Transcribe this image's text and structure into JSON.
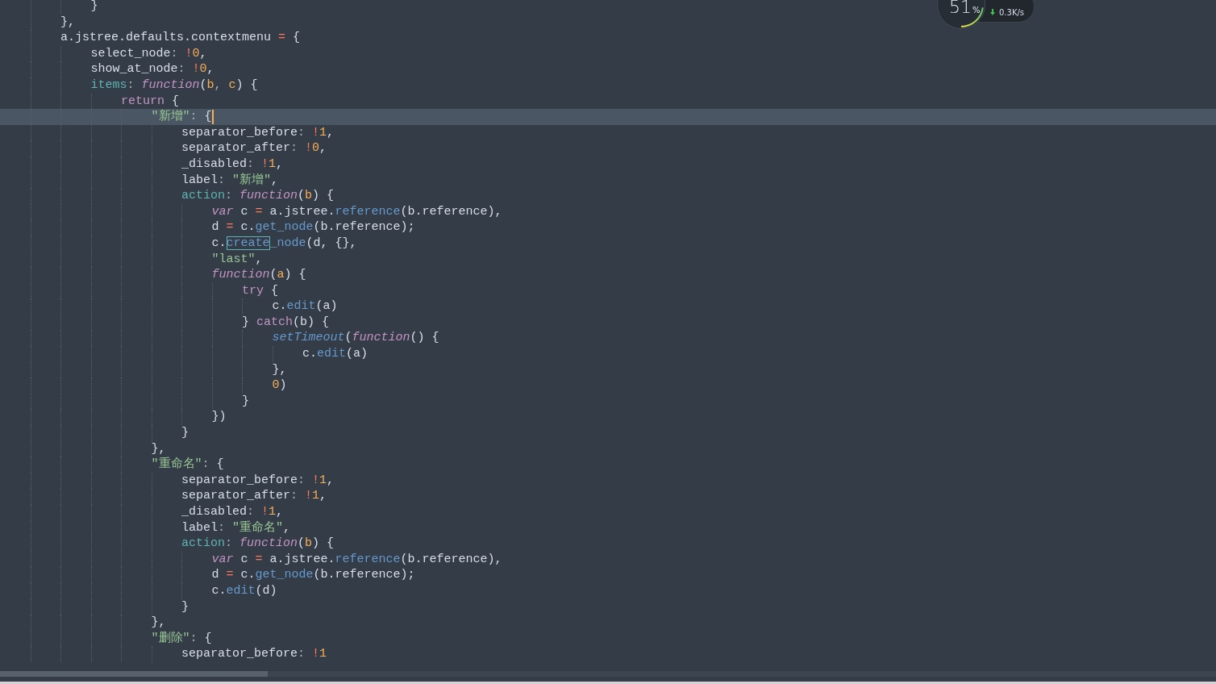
{
  "editor": {
    "lines": [
      {
        "children": [
          {
            "current": false,
            "tokens": [
              {
                "kind": "plain",
                "text": "}"
              }
            ]
          }
        ]
      },
      {
        "current": false,
        "tokens": [
          {
            "kind": "plain",
            "text": "},"
          }
        ]
      },
      {
        "current": false,
        "tokens": [
          {
            "kind": "plain",
            "text": "a.jstree.defaults.contextmenu "
          },
          {
            "kind": "op",
            "text": "="
          },
          {
            "kind": "plain",
            "text": " {"
          }
        ],
        "children": [
          {
            "current": false,
            "tokens": [
              {
                "kind": "plain",
                "text": "select_node"
              },
              {
                "kind": "punct",
                "text": ": "
              },
              {
                "kind": "op",
                "text": "!"
              },
              {
                "kind": "num",
                "text": "0"
              },
              {
                "kind": "plain",
                "text": ","
              }
            ]
          },
          {
            "current": false,
            "tokens": [
              {
                "kind": "plain",
                "text": "show_at_node"
              },
              {
                "kind": "punct",
                "text": ": "
              },
              {
                "kind": "op",
                "text": "!"
              },
              {
                "kind": "num",
                "text": "0"
              },
              {
                "kind": "plain",
                "text": ","
              }
            ]
          },
          {
            "current": false,
            "tokens": [
              {
                "kind": "prop",
                "text": "items"
              },
              {
                "kind": "punct",
                "text": ": "
              },
              {
                "kind": "fn",
                "text": "function"
              },
              {
                "kind": "plain",
                "text": "("
              },
              {
                "kind": "param",
                "text": "b"
              },
              {
                "kind": "punct",
                "text": ", "
              },
              {
                "kind": "param",
                "text": "c"
              },
              {
                "kind": "plain",
                "text": ") {"
              }
            ],
            "children": [
              {
                "current": false,
                "tokens": [
                  {
                    "kind": "kw",
                    "text": "return"
                  },
                  {
                    "kind": "plain",
                    "text": " {"
                  }
                ],
                "children": [
                  {
                    "current": true,
                    "caret": true,
                    "tokens": [
                      {
                        "kind": "str",
                        "text": "\"新增\""
                      },
                      {
                        "kind": "punct",
                        "text": ": "
                      },
                      {
                        "kind": "plain",
                        "text": "{"
                      }
                    ],
                    "children": [
                      {
                        "current": false,
                        "tokens": [
                          {
                            "kind": "plain",
                            "text": "separator_before"
                          },
                          {
                            "kind": "punct",
                            "text": ": "
                          },
                          {
                            "kind": "op",
                            "text": "!"
                          },
                          {
                            "kind": "num",
                            "text": "1"
                          },
                          {
                            "kind": "plain",
                            "text": ","
                          }
                        ]
                      },
                      {
                        "current": false,
                        "tokens": [
                          {
                            "kind": "plain",
                            "text": "separator_after"
                          },
                          {
                            "kind": "punct",
                            "text": ": "
                          },
                          {
                            "kind": "op",
                            "text": "!"
                          },
                          {
                            "kind": "num",
                            "text": "0"
                          },
                          {
                            "kind": "plain",
                            "text": ","
                          }
                        ]
                      },
                      {
                        "current": false,
                        "tokens": [
                          {
                            "kind": "plain",
                            "text": "_disabled"
                          },
                          {
                            "kind": "punct",
                            "text": ": "
                          },
                          {
                            "kind": "op",
                            "text": "!"
                          },
                          {
                            "kind": "num",
                            "text": "1"
                          },
                          {
                            "kind": "plain",
                            "text": ","
                          }
                        ]
                      },
                      {
                        "current": false,
                        "tokens": [
                          {
                            "kind": "plain",
                            "text": "label"
                          },
                          {
                            "kind": "punct",
                            "text": ": "
                          },
                          {
                            "kind": "str",
                            "text": "\"新增\""
                          },
                          {
                            "kind": "plain",
                            "text": ","
                          }
                        ]
                      },
                      {
                        "current": false,
                        "tokens": [
                          {
                            "kind": "prop",
                            "text": "action"
                          },
                          {
                            "kind": "punct",
                            "text": ": "
                          },
                          {
                            "kind": "fn",
                            "text": "function"
                          },
                          {
                            "kind": "plain",
                            "text": "("
                          },
                          {
                            "kind": "param",
                            "text": "b"
                          },
                          {
                            "kind": "plain",
                            "text": ") {"
                          }
                        ],
                        "children": [
                          {
                            "current": false,
                            "tokens": [
                              {
                                "kind": "fn",
                                "text": "var"
                              },
                              {
                                "kind": "plain",
                                "text": " c "
                              },
                              {
                                "kind": "op",
                                "text": "="
                              },
                              {
                                "kind": "plain",
                                "text": " a.jstree."
                              },
                              {
                                "kind": "method",
                                "text": "reference"
                              },
                              {
                                "kind": "plain",
                                "text": "(b.reference),"
                              }
                            ]
                          },
                          {
                            "current": false,
                            "tokens": [
                              {
                                "kind": "plain",
                                "text": "d "
                              },
                              {
                                "kind": "op",
                                "text": "="
                              },
                              {
                                "kind": "plain",
                                "text": " c."
                              },
                              {
                                "kind": "method",
                                "text": "get_node"
                              },
                              {
                                "kind": "plain",
                                "text": "(b.reference);"
                              }
                            ]
                          },
                          {
                            "current": false,
                            "tokens": [
                              {
                                "kind": "plain",
                                "text": "c."
                              },
                              {
                                "kind": "match",
                                "text": "create"
                              },
                              {
                                "kind": "method",
                                "text": "_node"
                              },
                              {
                                "kind": "plain",
                                "text": "(d, {},"
                              }
                            ]
                          },
                          {
                            "current": false,
                            "tokens": [
                              {
                                "kind": "str",
                                "text": "\"last\""
                              },
                              {
                                "kind": "plain",
                                "text": ","
                              }
                            ]
                          },
                          {
                            "current": false,
                            "tokens": [
                              {
                                "kind": "fn",
                                "text": "function"
                              },
                              {
                                "kind": "plain",
                                "text": "("
                              },
                              {
                                "kind": "param",
                                "text": "a"
                              },
                              {
                                "kind": "plain",
                                "text": ") {"
                              }
                            ],
                            "children": [
                              {
                                "current": false,
                                "tokens": [
                                  {
                                    "kind": "kw",
                                    "text": "try"
                                  },
                                  {
                                    "kind": "plain",
                                    "text": " {"
                                  }
                                ],
                                "children": [
                                  {
                                    "current": false,
                                    "tokens": [
                                      {
                                        "kind": "plain",
                                        "text": "c."
                                      },
                                      {
                                        "kind": "method",
                                        "text": "edit"
                                      },
                                      {
                                        "kind": "plain",
                                        "text": "(a)"
                                      }
                                    ]
                                  }
                                ]
                              },
                              {
                                "current": false,
                                "tokens": [
                                  {
                                    "kind": "plain",
                                    "text": "} "
                                  },
                                  {
                                    "kind": "kw",
                                    "text": "catch"
                                  },
                                  {
                                    "kind": "plain",
                                    "text": "(b) {"
                                  }
                                ],
                                "children": [
                                  {
                                    "current": false,
                                    "tokens": [
                                      {
                                        "kind": "builtin",
                                        "text": "setTimeout"
                                      },
                                      {
                                        "kind": "plain",
                                        "text": "("
                                      },
                                      {
                                        "kind": "fn",
                                        "text": "function"
                                      },
                                      {
                                        "kind": "plain",
                                        "text": "() {"
                                      }
                                    ],
                                    "children": [
                                      {
                                        "current": false,
                                        "tokens": [
                                          {
                                            "kind": "plain",
                                            "text": "c."
                                          },
                                          {
                                            "kind": "method",
                                            "text": "edit"
                                          },
                                          {
                                            "kind": "plain",
                                            "text": "(a)"
                                          }
                                        ]
                                      }
                                    ]
                                  },
                                  {
                                    "current": false,
                                    "tokens": [
                                      {
                                        "kind": "plain",
                                        "text": "},"
                                      }
                                    ]
                                  },
                                  {
                                    "current": false,
                                    "tokens": [
                                      {
                                        "kind": "num",
                                        "text": "0"
                                      },
                                      {
                                        "kind": "plain",
                                        "text": ")"
                                      }
                                    ]
                                  }
                                ]
                              },
                              {
                                "current": false,
                                "tokens": [
                                  {
                                    "kind": "plain",
                                    "text": "}"
                                  }
                                ]
                              }
                            ]
                          },
                          {
                            "current": false,
                            "tokens": [
                              {
                                "kind": "plain",
                                "text": "})"
                              }
                            ]
                          }
                        ]
                      },
                      {
                        "current": false,
                        "tokens": [
                          {
                            "kind": "plain",
                            "text": "}"
                          }
                        ]
                      }
                    ]
                  },
                  {
                    "current": false,
                    "tokens": [
                      {
                        "kind": "plain",
                        "text": "},"
                      }
                    ]
                  },
                  {
                    "current": false,
                    "tokens": [
                      {
                        "kind": "str",
                        "text": "\"重命名\""
                      },
                      {
                        "kind": "punct",
                        "text": ": "
                      },
                      {
                        "kind": "plain",
                        "text": "{"
                      }
                    ],
                    "children": [
                      {
                        "current": false,
                        "tokens": [
                          {
                            "kind": "plain",
                            "text": "separator_before"
                          },
                          {
                            "kind": "punct",
                            "text": ": "
                          },
                          {
                            "kind": "op",
                            "text": "!"
                          },
                          {
                            "kind": "num",
                            "text": "1"
                          },
                          {
                            "kind": "plain",
                            "text": ","
                          }
                        ]
                      },
                      {
                        "current": false,
                        "tokens": [
                          {
                            "kind": "plain",
                            "text": "separator_after"
                          },
                          {
                            "kind": "punct",
                            "text": ": "
                          },
                          {
                            "kind": "op",
                            "text": "!"
                          },
                          {
                            "kind": "num",
                            "text": "1"
                          },
                          {
                            "kind": "plain",
                            "text": ","
                          }
                        ]
                      },
                      {
                        "current": false,
                        "tokens": [
                          {
                            "kind": "plain",
                            "text": "_disabled"
                          },
                          {
                            "kind": "punct",
                            "text": ": "
                          },
                          {
                            "kind": "op",
                            "text": "!"
                          },
                          {
                            "kind": "num",
                            "text": "1"
                          },
                          {
                            "kind": "plain",
                            "text": ","
                          }
                        ]
                      },
                      {
                        "current": false,
                        "tokens": [
                          {
                            "kind": "plain",
                            "text": "label"
                          },
                          {
                            "kind": "punct",
                            "text": ": "
                          },
                          {
                            "kind": "str",
                            "text": "\"重命名\""
                          },
                          {
                            "kind": "plain",
                            "text": ","
                          }
                        ]
                      },
                      {
                        "current": false,
                        "tokens": [
                          {
                            "kind": "prop",
                            "text": "action"
                          },
                          {
                            "kind": "punct",
                            "text": ": "
                          },
                          {
                            "kind": "fn",
                            "text": "function"
                          },
                          {
                            "kind": "plain",
                            "text": "("
                          },
                          {
                            "kind": "param",
                            "text": "b"
                          },
                          {
                            "kind": "plain",
                            "text": ") {"
                          }
                        ],
                        "children": [
                          {
                            "current": false,
                            "tokens": [
                              {
                                "kind": "fn",
                                "text": "var"
                              },
                              {
                                "kind": "plain",
                                "text": " c "
                              },
                              {
                                "kind": "op",
                                "text": "="
                              },
                              {
                                "kind": "plain",
                                "text": " a.jstree."
                              },
                              {
                                "kind": "method",
                                "text": "reference"
                              },
                              {
                                "kind": "plain",
                                "text": "(b.reference),"
                              }
                            ]
                          },
                          {
                            "current": false,
                            "tokens": [
                              {
                                "kind": "plain",
                                "text": "d "
                              },
                              {
                                "kind": "op",
                                "text": "="
                              },
                              {
                                "kind": "plain",
                                "text": " c."
                              },
                              {
                                "kind": "method",
                                "text": "get_node"
                              },
                              {
                                "kind": "plain",
                                "text": "(b.reference);"
                              }
                            ]
                          },
                          {
                            "current": false,
                            "tokens": [
                              {
                                "kind": "plain",
                                "text": "c."
                              },
                              {
                                "kind": "method",
                                "text": "edit"
                              },
                              {
                                "kind": "plain",
                                "text": "(d)"
                              }
                            ]
                          }
                        ]
                      },
                      {
                        "current": false,
                        "tokens": [
                          {
                            "kind": "plain",
                            "text": "}"
                          }
                        ]
                      }
                    ]
                  },
                  {
                    "current": false,
                    "tokens": [
                      {
                        "kind": "plain",
                        "text": "},"
                      }
                    ]
                  },
                  {
                    "current": false,
                    "tokens": [
                      {
                        "kind": "str",
                        "text": "\"删除\""
                      },
                      {
                        "kind": "punct",
                        "text": ": "
                      },
                      {
                        "kind": "plain",
                        "text": "{"
                      }
                    ],
                    "children": [
                      {
                        "current": false,
                        "tokens": [
                          {
                            "kind": "plain",
                            "text": "separator_before"
                          },
                          {
                            "kind": "punct",
                            "text": ": "
                          },
                          {
                            "kind": "op",
                            "text": "!"
                          },
                          {
                            "kind": "num",
                            "text": "1"
                          }
                        ]
                      }
                    ]
                  }
                ]
              }
            ]
          }
        ]
      }
    ]
  },
  "monitor": {
    "percent": "51",
    "percent_sign": "%",
    "level": 0.51,
    "download": "0.3K/s"
  }
}
